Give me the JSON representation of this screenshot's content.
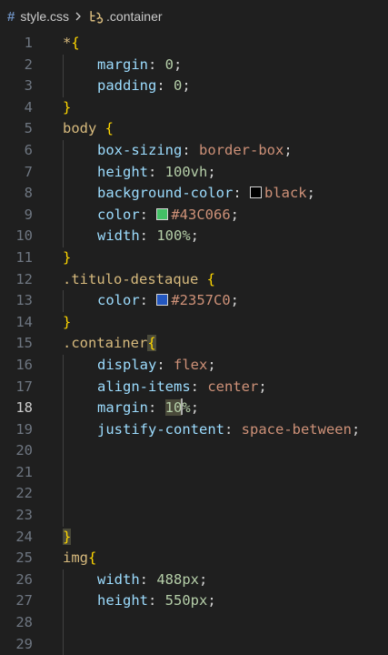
{
  "breadcrumb": {
    "file_icon": "#",
    "file": "style.css",
    "separator": "chevron-right",
    "symbol": ".container"
  },
  "active_line": 18,
  "colors": {
    "background": "#1f1f1f",
    "selector": "#d7ba7d",
    "brace": "#ffd700",
    "property": "#9cdcfe",
    "number": "#b5cea8",
    "value": "#ce9178",
    "line_number": "#6e7681"
  },
  "lines": [
    {
      "n": "1",
      "indent": 0,
      "tokens": [
        {
          "t": "*",
          "c": "sel"
        },
        {
          "t": "{",
          "c": "brace"
        }
      ]
    },
    {
      "n": "2",
      "indent": 1,
      "tokens": [
        {
          "t": "margin",
          "c": "prop"
        },
        {
          "t": ": ",
          "c": "punc"
        },
        {
          "t": "0",
          "c": "num"
        },
        {
          "t": ";",
          "c": "punc"
        }
      ]
    },
    {
      "n": "3",
      "indent": 1,
      "tokens": [
        {
          "t": "padding",
          "c": "prop"
        },
        {
          "t": ": ",
          "c": "punc"
        },
        {
          "t": "0",
          "c": "num"
        },
        {
          "t": ";",
          "c": "punc"
        }
      ]
    },
    {
      "n": "4",
      "indent": 0,
      "tokens": [
        {
          "t": "}",
          "c": "brace"
        }
      ]
    },
    {
      "n": "5",
      "indent": 0,
      "tokens": [
        {
          "t": "body",
          "c": "sel"
        },
        {
          "t": " ",
          "c": "punc"
        },
        {
          "t": "{",
          "c": "brace"
        }
      ]
    },
    {
      "n": "6",
      "indent": 1,
      "tokens": [
        {
          "t": "box-sizing",
          "c": "prop"
        },
        {
          "t": ": ",
          "c": "punc"
        },
        {
          "t": "border-box",
          "c": "str"
        },
        {
          "t": ";",
          "c": "punc"
        }
      ]
    },
    {
      "n": "7",
      "indent": 1,
      "tokens": [
        {
          "t": "height",
          "c": "prop"
        },
        {
          "t": ": ",
          "c": "punc"
        },
        {
          "t": "100vh",
          "c": "num"
        },
        {
          "t": ";",
          "c": "punc"
        }
      ]
    },
    {
      "n": "8",
      "indent": 1,
      "tokens": [
        {
          "t": "background-color",
          "c": "prop"
        },
        {
          "t": ": ",
          "c": "punc"
        },
        {
          "swatch": "#000000"
        },
        {
          "t": "black",
          "c": "str"
        },
        {
          "t": ";",
          "c": "punc"
        }
      ]
    },
    {
      "n": "9",
      "indent": 1,
      "tokens": [
        {
          "t": "color",
          "c": "prop"
        },
        {
          "t": ": ",
          "c": "punc"
        },
        {
          "swatch": "#43C066"
        },
        {
          "t": "#43C066",
          "c": "str"
        },
        {
          "t": ";",
          "c": "punc"
        }
      ]
    },
    {
      "n": "10",
      "indent": 1,
      "tokens": [
        {
          "t": "width",
          "c": "prop"
        },
        {
          "t": ": ",
          "c": "punc"
        },
        {
          "t": "100%",
          "c": "num"
        },
        {
          "t": ";",
          "c": "punc"
        }
      ]
    },
    {
      "n": "11",
      "indent": 0,
      "tokens": [
        {
          "t": "}",
          "c": "brace"
        }
      ]
    },
    {
      "n": "12",
      "indent": 0,
      "tokens": [
        {
          "t": ".titulo-destaque",
          "c": "sel"
        },
        {
          "t": " ",
          "c": "punc"
        },
        {
          "t": "{",
          "c": "brace"
        }
      ]
    },
    {
      "n": "13",
      "indent": 1,
      "tokens": [
        {
          "t": "color",
          "c": "prop"
        },
        {
          "t": ": ",
          "c": "punc"
        },
        {
          "swatch": "#2357C0"
        },
        {
          "t": "#2357C0",
          "c": "str"
        },
        {
          "t": ";",
          "c": "punc"
        }
      ]
    },
    {
      "n": "14",
      "indent": 0,
      "tokens": [
        {
          "t": "}",
          "c": "brace"
        }
      ]
    },
    {
      "n": "15",
      "indent": 0,
      "tokens": [
        {
          "t": ".container",
          "c": "sel"
        },
        {
          "t": "{",
          "c": "brace",
          "hl": true
        }
      ]
    },
    {
      "n": "16",
      "indent": 1,
      "tokens": [
        {
          "t": "display",
          "c": "prop"
        },
        {
          "t": ": ",
          "c": "punc"
        },
        {
          "t": "flex",
          "c": "str"
        },
        {
          "t": ";",
          "c": "punc"
        }
      ]
    },
    {
      "n": "17",
      "indent": 1,
      "tokens": [
        {
          "t": "align-items",
          "c": "prop"
        },
        {
          "t": ": ",
          "c": "punc"
        },
        {
          "t": "center",
          "c": "str"
        },
        {
          "t": ";",
          "c": "punc"
        }
      ]
    },
    {
      "n": "18",
      "indent": 1,
      "tokens": [
        {
          "t": "margin",
          "c": "prop"
        },
        {
          "t": ": ",
          "c": "punc"
        },
        {
          "t": "10",
          "c": "num",
          "hl": true
        },
        {
          "cursor": true
        },
        {
          "t": "%",
          "c": "num"
        },
        {
          "t": ";",
          "c": "punc"
        }
      ]
    },
    {
      "n": "19",
      "indent": 1,
      "tokens": [
        {
          "t": "justify-content",
          "c": "prop"
        },
        {
          "t": ": ",
          "c": "punc"
        },
        {
          "t": "space-between",
          "c": "str"
        },
        {
          "t": ";",
          "c": "punc"
        }
      ]
    },
    {
      "n": "20",
      "indent": 1,
      "tokens": []
    },
    {
      "n": "21",
      "indent": 1,
      "tokens": []
    },
    {
      "n": "22",
      "indent": 1,
      "tokens": []
    },
    {
      "n": "23",
      "indent": 1,
      "tokens": []
    },
    {
      "n": "24",
      "indent": 0,
      "tokens": [
        {
          "t": "}",
          "c": "brace",
          "hl": true
        }
      ]
    },
    {
      "n": "25",
      "indent": 0,
      "tokens": [
        {
          "t": "img",
          "c": "sel"
        },
        {
          "t": "{",
          "c": "brace"
        }
      ]
    },
    {
      "n": "26",
      "indent": 1,
      "tokens": [
        {
          "t": "width",
          "c": "prop"
        },
        {
          "t": ": ",
          "c": "punc"
        },
        {
          "t": "488px",
          "c": "num"
        },
        {
          "t": ";",
          "c": "punc"
        }
      ]
    },
    {
      "n": "27",
      "indent": 1,
      "tokens": [
        {
          "t": "height",
          "c": "prop"
        },
        {
          "t": ": ",
          "c": "punc"
        },
        {
          "t": "550px",
          "c": "num"
        },
        {
          "t": ";",
          "c": "punc"
        }
      ]
    },
    {
      "n": "28",
      "indent": 1,
      "tokens": []
    },
    {
      "n": "29",
      "indent": 1,
      "tokens": []
    }
  ]
}
